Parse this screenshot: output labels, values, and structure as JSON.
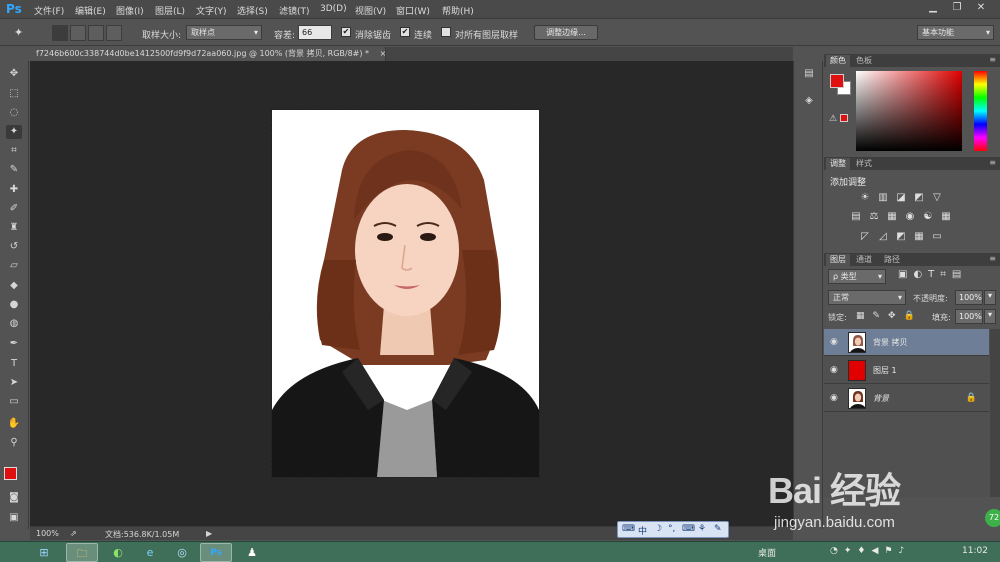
{
  "app": {
    "logo": "Ps"
  },
  "menu": [
    "文件(F)",
    "编辑(E)",
    "图像(I)",
    "图层(L)",
    "文字(Y)",
    "选择(S)",
    "滤镜(T)",
    "3D(D)",
    "视图(V)",
    "窗口(W)",
    "帮助(H)"
  ],
  "window_controls": {
    "minimize": "▁",
    "maximize": "❐",
    "close": "✕"
  },
  "options": {
    "sample_size_label": "取样大小:",
    "sample_size_value": "取样点",
    "tolerance_label": "容差:",
    "tolerance_value": "66",
    "anti_alias_label": "消除锯齿",
    "anti_alias_checked": "✔",
    "contiguous_label": "连续",
    "contiguous_checked": "✔",
    "all_layers_label": "对所有图层取样",
    "all_layers_checked": "",
    "refine_edge_button": "调整边缘...",
    "workspace": "基本功能"
  },
  "document": {
    "tab_title": "f7246b600c338744d0be1412500fd9f9d72aa060.jpg @ 100% (背景 拷贝, RGB/8#) *",
    "tab_close": "×"
  },
  "status": {
    "zoom": "100%",
    "doc_info": "文档:536.8K/1.05M",
    "arrow": "▶"
  },
  "panels": {
    "color": {
      "tabs": [
        "颜色",
        "色板"
      ],
      "fg_color": "#e01010",
      "bg_color": "#ffffff",
      "warning": "⚠"
    },
    "adjustments": {
      "tabs": [
        "调整",
        "样式"
      ],
      "title": "添加调整",
      "icons": [
        "☀",
        "▥",
        "◪",
        "◩",
        "▽",
        "▤",
        "⚖",
        "▦",
        "◉",
        "☯",
        "▦",
        "◸",
        "◿",
        "◩",
        "▦",
        "▭"
      ]
    },
    "layers": {
      "tabs": [
        "图层",
        "通道",
        "路径"
      ],
      "filter_label": "ρ 类型",
      "blend_mode": "正常",
      "opacity_label": "不透明度:",
      "opacity_value": "100%",
      "lock_label": "锁定:",
      "fill_label": "填充:",
      "fill_value": "100%",
      "items": [
        {
          "name": "背景 拷贝",
          "thumb": "photo",
          "selected": true
        },
        {
          "name": "图层 1",
          "thumb": "red",
          "selected": false
        },
        {
          "name": "背景",
          "thumb": "photo",
          "selected": false
        }
      ]
    }
  },
  "ime": {
    "segments": [
      "⌨",
      "中",
      "☽",
      "°,",
      "⌨",
      "⚘",
      "✎"
    ]
  },
  "taskbar": {
    "start_icon": "⊞",
    "apps": [
      "🗀",
      "◐",
      "e",
      "◎",
      "Ps",
      "♟"
    ],
    "tray_desktop": "桌面",
    "clock": "11:02"
  },
  "watermark": {
    "logo": "Bai 经验",
    "url": "jingyan.baidu.com",
    "badge": "72"
  }
}
